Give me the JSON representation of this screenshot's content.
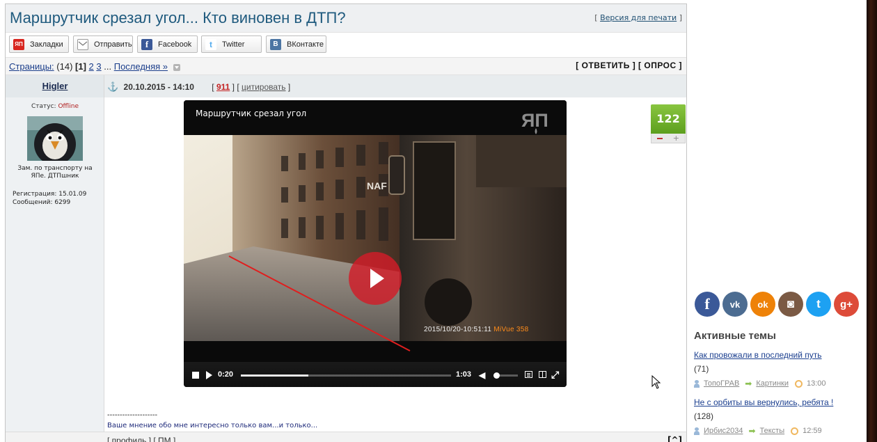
{
  "post": {
    "title": "Маршрутчик срезал угол... Кто виновен в ДТП?",
    "print_link": "Версия для печати"
  },
  "share_buttons": [
    {
      "label": "Закладки",
      "icon": "yap-logo-icon",
      "color": "#d8261f"
    },
    {
      "label": "Отправить",
      "icon": "envelope-icon",
      "color": "#9a9a9a"
    },
    {
      "label": "Facebook",
      "icon": "facebook-icon",
      "color": "#3b5998"
    },
    {
      "label": "Twitter",
      "icon": "twitter-icon",
      "color": "#55acee"
    },
    {
      "label": "ВКонтакте",
      "icon": "vk-icon",
      "color": "#4c75a3"
    }
  ],
  "pagination": {
    "label": "Страницы:",
    "count": "(14)",
    "current": "[1]",
    "page2": "2",
    "page3": "3",
    "ellipsis": "...",
    "last": "Последняя »"
  },
  "actions": {
    "reply": "[ ОТВЕТИТЬ ]",
    "poll": "[ ОПРОС ]"
  },
  "author": {
    "name": "Higler",
    "status_label": "Статус:",
    "status_value": "Offline",
    "title": "Зам. по транспорту на ЯПе. ДТПшник",
    "reg_label": "Регистрация:",
    "reg_value": "15.01.09",
    "posts_label": "Сообщений:",
    "posts_value": "6299"
  },
  "meta": {
    "datetime": "20.10.2015 - 14:10",
    "post_number": "911",
    "quote": "цитировать"
  },
  "video": {
    "title": "Маршрутчик срезал угол",
    "logo_text": "ЯП",
    "overlay_date": "2015/10/20-10:51:11",
    "overlay_brand": "MiVue 358",
    "storefront_text": "NAF",
    "current_time": "0:20",
    "duration": "1:03",
    "progress": 0.32,
    "volume": 0
  },
  "rating": {
    "value": "122",
    "minus": "–",
    "plus": "+"
  },
  "signature": {
    "dashes": "--------------------",
    "text": "Ваше мнение обо мне интересно только вам...и только..."
  },
  "footer": {
    "profile": "профиль",
    "pm": "ПМ",
    "top": "[^]"
  },
  "social": [
    {
      "name": "facebook-icon",
      "glyph": "f",
      "color": "#3b5998"
    },
    {
      "name": "vk-icon",
      "glyph": "vk",
      "color": "#4c6c91"
    },
    {
      "name": "odnoklassniki-icon",
      "glyph": "ok",
      "color": "#ee8208"
    },
    {
      "name": "instagram-icon",
      "glyph": "◙",
      "color": "#7b5a44"
    },
    {
      "name": "twitter-icon",
      "glyph": "t",
      "color": "#1da1f2"
    },
    {
      "name": "googleplus-icon",
      "glyph": "g+",
      "color": "#dd4b39"
    }
  ],
  "active_topics": {
    "heading": "Активные темы",
    "items": [
      {
        "title": "Как провожали в последний путь",
        "count": "(71)",
        "user": "ТопоГРАВ",
        "category": "Картинки",
        "time": "13:00"
      },
      {
        "title": "Не с орбиты вы вернулись, ребята !",
        "count": "(128)",
        "user": "Ирбис2034",
        "category": "Тексты",
        "time": "12:59"
      }
    ]
  }
}
